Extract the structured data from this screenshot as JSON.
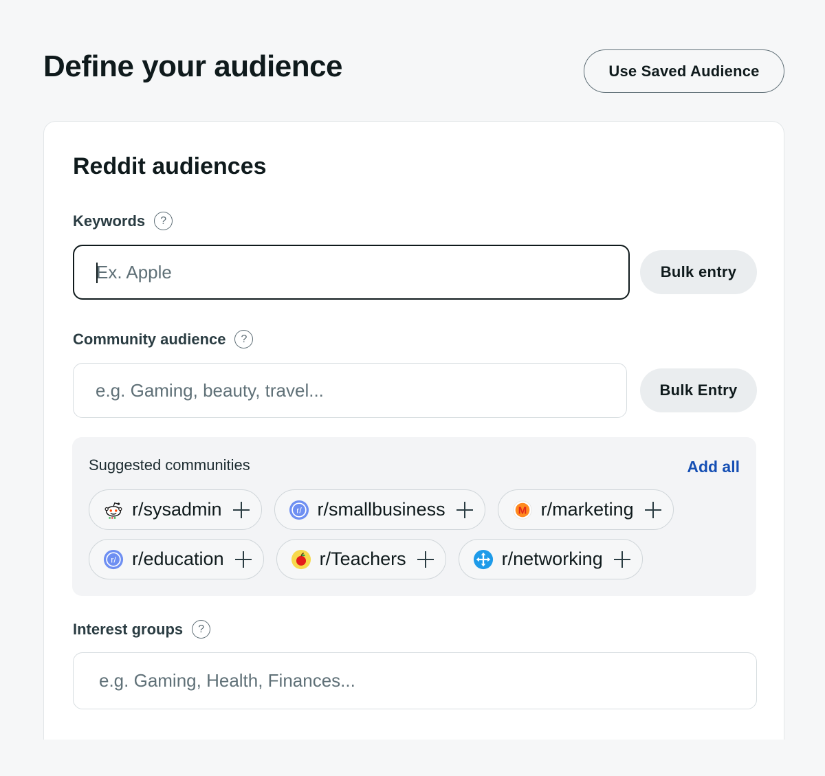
{
  "header": {
    "title": "Define your audience",
    "saved_audience_button": "Use Saved Audience"
  },
  "card": {
    "title": "Reddit audiences",
    "keywords": {
      "label": "Keywords",
      "help": "?",
      "placeholder": "Ex. Apple",
      "value": "",
      "bulk_button": "Bulk entry"
    },
    "community": {
      "label": "Community audience",
      "help": "?",
      "placeholder": "e.g. Gaming, beauty, travel...",
      "value": "",
      "bulk_button": "Bulk Entry"
    },
    "suggested": {
      "title": "Suggested communities",
      "add_all": "Add all",
      "rows": [
        [
          {
            "label": "r/sysadmin",
            "icon": "reddit-snoo-icon"
          },
          {
            "label": "r/smallbusiness",
            "icon": "community-default-icon"
          },
          {
            "label": "r/marketing",
            "icon": "marketing-m-icon"
          }
        ],
        [
          {
            "label": "r/education",
            "icon": "community-default-icon"
          },
          {
            "label": "r/Teachers",
            "icon": "apple-icon"
          },
          {
            "label": "r/networking",
            "icon": "network-arrows-icon"
          }
        ]
      ]
    },
    "interest": {
      "label": "Interest groups",
      "help": "?",
      "placeholder": "e.g. Gaming, Health, Finances...",
      "value": ""
    }
  }
}
